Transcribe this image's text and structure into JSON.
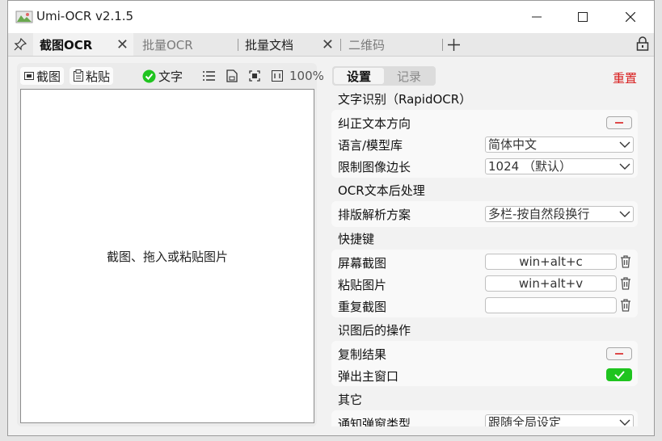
{
  "window": {
    "title": "Umi-OCR v2.1.5",
    "icons": [
      "app-icon",
      "minimize-icon",
      "maximize-icon",
      "close-icon"
    ]
  },
  "tabs": [
    {
      "label": "截图OCR",
      "active": true,
      "closable": true
    },
    {
      "label": "批量OCR",
      "active": false,
      "closable": false
    },
    {
      "label": "批量文档",
      "active": false,
      "closable": true
    },
    {
      "label": "二维码",
      "active": false,
      "closable": false
    }
  ],
  "tabbar_icons": [
    "pin-icon",
    "plus-icon",
    "lock-icon"
  ],
  "left_toolbar": {
    "screenshot_label": "截图",
    "paste_label": "粘贴",
    "text_label": "文字",
    "zoom": "100%"
  },
  "canvas": {
    "hint": "截图、拖入或粘贴图片"
  },
  "right": {
    "seg_settings": "设置",
    "seg_records": "记录",
    "reset": "重置",
    "sections": {
      "ocr": "文字识别（RapidOCR）",
      "post": "OCR文本后处理",
      "hotkeys": "快捷键",
      "after": "识图后的操作",
      "other": "其它"
    },
    "rows": {
      "correct_dir": "纠正文本方向",
      "language": "语言/模型库",
      "language_value": "简体中文",
      "limit": "限制图像边长",
      "limit_value": "1024 （默认）",
      "layout": "排版解析方案",
      "layout_value": "多栏-按自然段换行",
      "hk_screenshot": "屏幕截图",
      "hk_screenshot_value": "win+alt+c",
      "hk_paste": "粘贴图片",
      "hk_paste_value": "win+alt+v",
      "hk_repeat": "重复截图",
      "hk_repeat_value": "",
      "copy_result": "复制结果",
      "popup_main": "弹出主窗口",
      "notify": "通知弹窗类型",
      "notify_value": "跟随全局设定"
    },
    "toggles": {
      "correct_dir": false,
      "copy_result": false,
      "popup_main": true
    },
    "colors": {
      "reset": "#d81e1e",
      "toggle_on": "#1fc41f",
      "check": "#1fc41f"
    }
  }
}
